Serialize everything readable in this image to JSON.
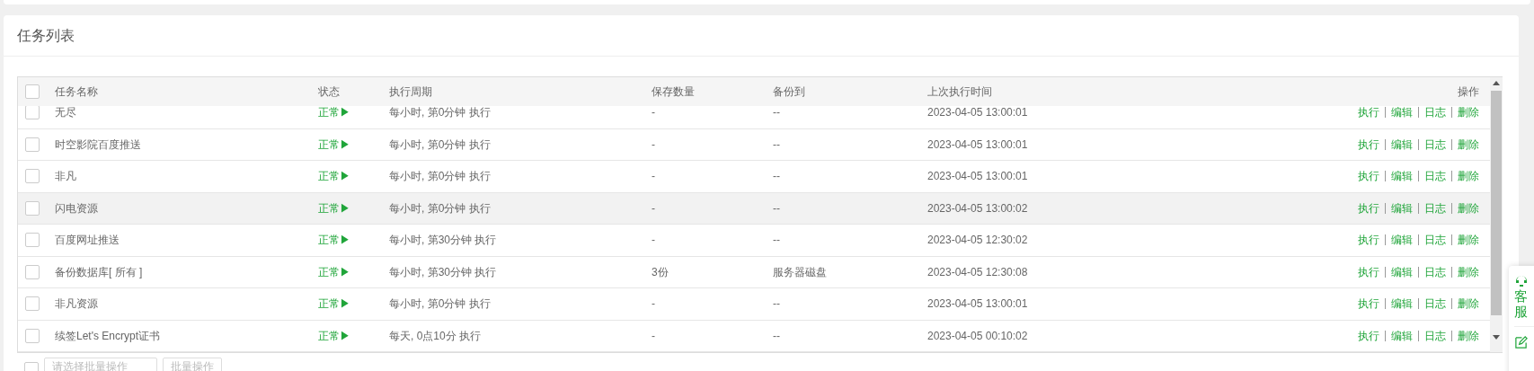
{
  "panel": {
    "title": "任务列表"
  },
  "table": {
    "columns": [
      "任务名称",
      "状态",
      "执行周期",
      "保存数量",
      "备份到",
      "上次执行时间",
      "操作"
    ],
    "rows": [
      {
        "checked": false,
        "hovered": false,
        "name": "无尽",
        "status": "正常▶",
        "cycle": "每小时, 第0分钟 执行",
        "keep": "-",
        "backup_to": "--",
        "last_run": "2023-04-05 13:00:01",
        "actions": [
          "执行",
          "编辑",
          "日志",
          "删除"
        ]
      },
      {
        "checked": false,
        "hovered": false,
        "name": "时空影院百度推送",
        "status": "正常▶",
        "cycle": "每小时, 第0分钟 执行",
        "keep": "-",
        "backup_to": "--",
        "last_run": "2023-04-05 13:00:01",
        "actions": [
          "执行",
          "编辑",
          "日志",
          "删除"
        ]
      },
      {
        "checked": false,
        "hovered": false,
        "name": "非凡",
        "status": "正常▶",
        "cycle": "每小时, 第0分钟 执行",
        "keep": "-",
        "backup_to": "--",
        "last_run": "2023-04-05 13:00:01",
        "actions": [
          "执行",
          "编辑",
          "日志",
          "删除"
        ]
      },
      {
        "checked": false,
        "hovered": true,
        "name": "闪电资源",
        "status": "正常▶",
        "cycle": "每小时, 第0分钟 执行",
        "keep": "-",
        "backup_to": "--",
        "last_run": "2023-04-05 13:00:02",
        "actions": [
          "执行",
          "编辑",
          "日志",
          "删除"
        ]
      },
      {
        "checked": false,
        "hovered": false,
        "name": "百度网址推送",
        "status": "正常▶",
        "cycle": "每小时, 第30分钟 执行",
        "keep": "-",
        "backup_to": "--",
        "last_run": "2023-04-05 12:30:02",
        "actions": [
          "执行",
          "编辑",
          "日志",
          "删除"
        ]
      },
      {
        "checked": false,
        "hovered": false,
        "name": "备份数据库[ 所有 ]",
        "status": "正常▶",
        "cycle": "每小时, 第30分钟 执行",
        "keep": "3份",
        "backup_to": "服务器磁盘",
        "last_run": "2023-04-05 12:30:08",
        "actions": [
          "执行",
          "编辑",
          "日志",
          "删除"
        ]
      },
      {
        "checked": false,
        "hovered": false,
        "name": "非凡资源",
        "status": "正常▶",
        "cycle": "每小时, 第0分钟 执行",
        "keep": "-",
        "backup_to": "--",
        "last_run": "2023-04-05 13:00:01",
        "actions": [
          "执行",
          "编辑",
          "日志",
          "删除"
        ]
      },
      {
        "checked": false,
        "hovered": false,
        "name": "续签Let's Encrypt证书",
        "status": "正常▶",
        "cycle": "每天, 0点10分 执行",
        "keep": "-",
        "backup_to": "--",
        "last_run": "2023-04-05 00:10:02",
        "actions": [
          "执行",
          "编辑",
          "日志",
          "删除"
        ]
      }
    ],
    "select_all": {
      "checked": false
    }
  },
  "batch": {
    "select_placeholder": "请选择批量操作",
    "button": "批量操作"
  },
  "side_widget": {
    "service": "客服"
  }
}
